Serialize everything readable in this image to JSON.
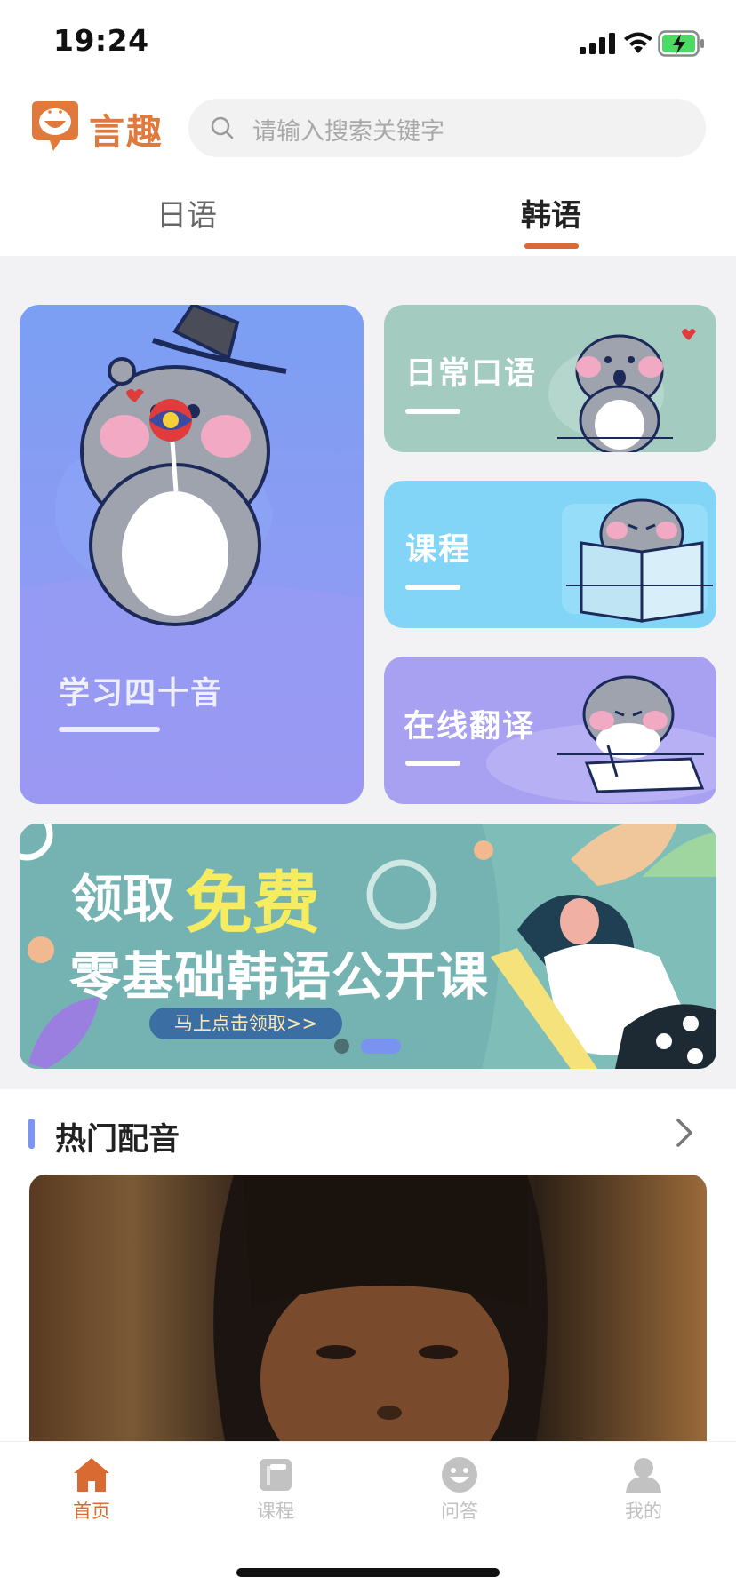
{
  "status_bar": {
    "time": "19:24"
  },
  "header": {
    "brand": "言趣",
    "search": {
      "placeholder": "请输入搜索关键字"
    }
  },
  "tabs": [
    {
      "label": "日语",
      "active": false
    },
    {
      "label": "韩语",
      "active": true
    }
  ],
  "feature_cards": {
    "big": {
      "label": "学习四十音"
    },
    "daily": {
      "label": "日常口语"
    },
    "course": {
      "label": "课程"
    },
    "translate": {
      "label": "在线翻译"
    }
  },
  "banner": {
    "line1_a": "领取",
    "line1_b": "免费",
    "line2": "零基础韩语公开课",
    "button": "马上点击领取>>",
    "page_index": 2,
    "page_count": 2
  },
  "hot_dubbing": {
    "title": "热门配音"
  },
  "bottom_nav": [
    {
      "label": "首页",
      "active": true,
      "icon": "home-icon"
    },
    {
      "label": "课程",
      "active": false,
      "icon": "book-icon"
    },
    {
      "label": "问答",
      "active": false,
      "icon": "chat-face-icon"
    },
    {
      "label": "我的",
      "active": false,
      "icon": "person-icon"
    }
  ],
  "colors": {
    "accent": "#d96b32",
    "inactive": "#c2c2c2",
    "brand": "#e07a3c"
  }
}
